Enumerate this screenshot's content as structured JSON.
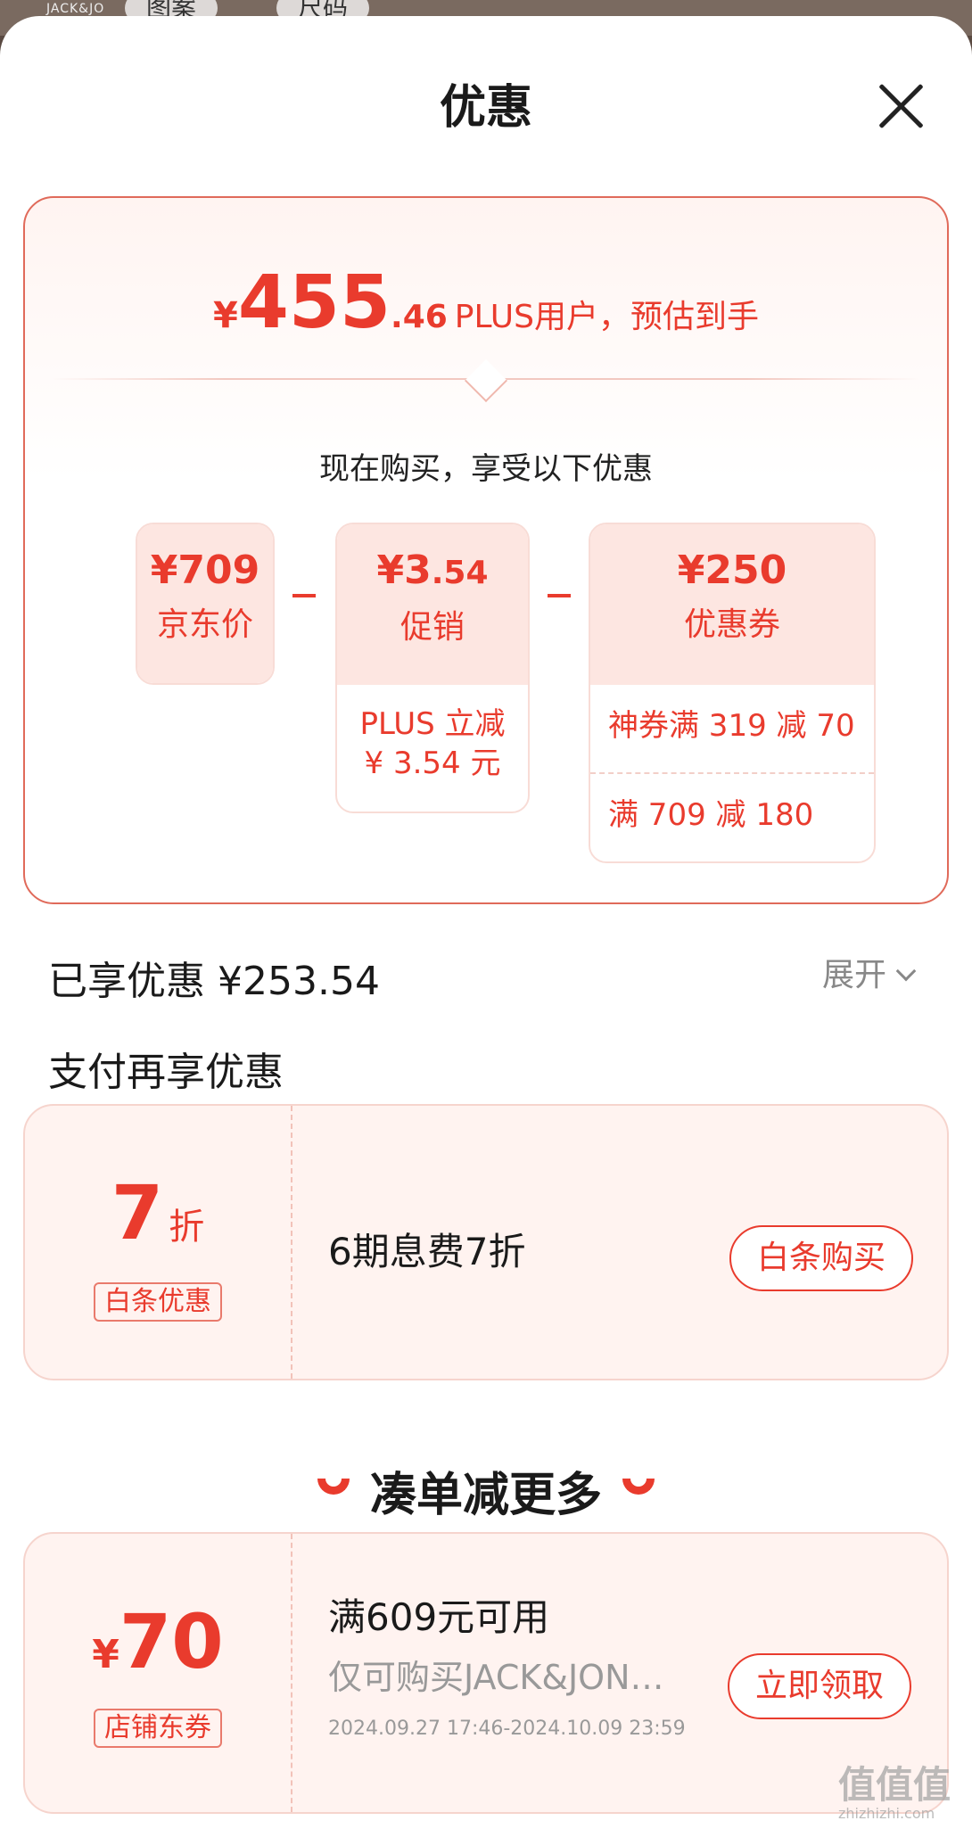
{
  "background": {
    "top_pills": [
      "图案",
      "尺码"
    ],
    "brand_fragment": "JACK&JO"
  },
  "sheet": {
    "title": "优惠"
  },
  "summary": {
    "currency": "¥",
    "price_int": "455",
    "price_dec": ".46",
    "price_label": "PLUS用户，预估到手",
    "subtitle": "现在购买，享受以下优惠",
    "items": [
      {
        "value": "¥709",
        "label": "京东价",
        "details": []
      },
      {
        "value_int": "¥3",
        "value_dec": ".54",
        "label": "促销",
        "details": [
          "PLUS 立减",
          "¥ 3.54 元"
        ]
      },
      {
        "value": "¥250",
        "label": "优惠券",
        "details": [
          "神券满 319 减 70",
          "满 709 减 180"
        ]
      }
    ],
    "minus_sign": "-"
  },
  "enjoyed": {
    "label": "已享优惠 ¥253.54",
    "expand_label": "展开"
  },
  "pay_more": {
    "title": "支付再享优惠",
    "coupon": {
      "value": "7",
      "unit": "折",
      "tag": "白条优惠",
      "desc": "6期息费7折",
      "button": "白条购买"
    }
  },
  "more": {
    "title": "凑单减更多",
    "coupon": {
      "currency": "¥",
      "value": "70",
      "tag": "店铺东券",
      "title": "满609元可用",
      "desc": "仅可购买JACK&JON…",
      "period": "2024.09.27 17:46-2024.10.09 23:59",
      "button": "立即领取"
    }
  },
  "watermark": {
    "main": "值值值",
    "sub": "zhizhizhi.com"
  },
  "colors": {
    "accent": "#e93b2d",
    "accent_light": "#fde6e1",
    "card_border": "#e06a5a"
  }
}
